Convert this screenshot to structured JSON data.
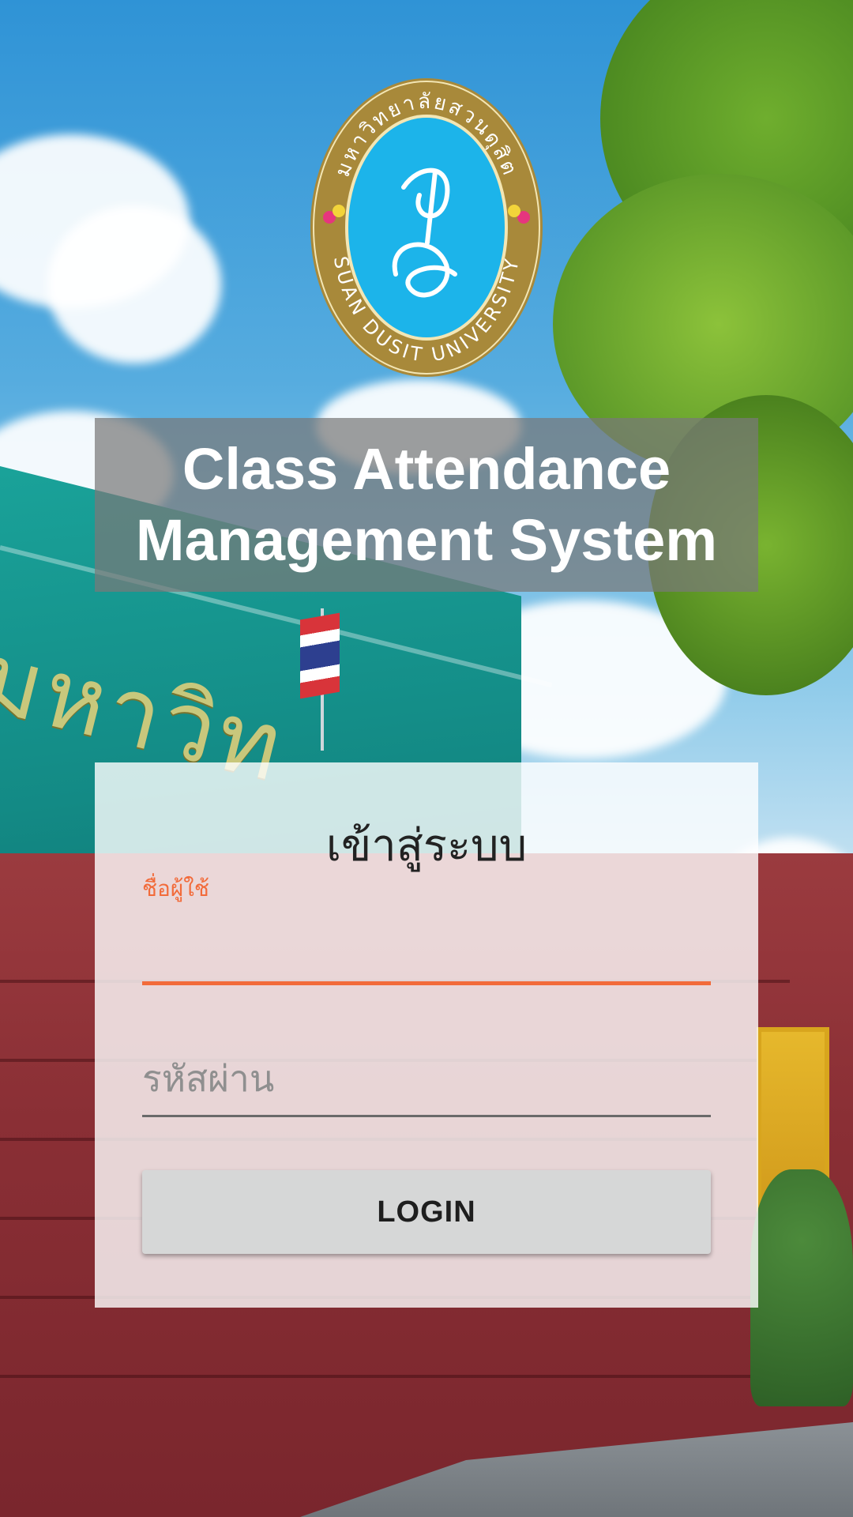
{
  "app": {
    "title_line1": "Class Attendance",
    "title_line2": "Management System"
  },
  "logo": {
    "arc_top": "มหาวิทยาลัยสวนดุสิต",
    "arc_bottom": "SUAN DUSIT UNIVERSITY",
    "icon": "university-seal"
  },
  "background": {
    "sign_text": "มหาวิท"
  },
  "login": {
    "heading": "เข้าสู่ระบบ",
    "username_label": "ชื่อผู้ใช้",
    "username_value": "",
    "password_placeholder": "รหัสผ่าน",
    "button_label": "LOGIN"
  },
  "colors": {
    "accent": "#f26b3a",
    "seal_gold": "#a8893a",
    "seal_blue": "#1cb4ea",
    "button_bg": "#d6d7d7"
  }
}
